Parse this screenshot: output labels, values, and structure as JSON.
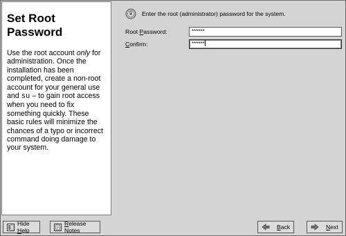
{
  "help": {
    "title": "Set Root Password",
    "para_1": "Use the root account ",
    "para_only": "only",
    "para_2": " for administration. Once the installation has been completed, create a non-root account for your general use and ",
    "para_cmd": "su",
    "para_3": "  – to gain root access when you need to fix something quickly. These basic rules will minimize the chances of a typo or incorrect command doing damage to your system."
  },
  "intro": {
    "text": "Enter the root (administrator) password for the system.",
    "icon": "shield-badge-icon"
  },
  "form": {
    "root_password_label_pre": "Root ",
    "root_password_label_key": "P",
    "root_password_label_post": "assword:",
    "root_password_value": "******",
    "confirm_label_key": "C",
    "confirm_label_post": "onfirm:",
    "confirm_value": "******"
  },
  "buttons": {
    "hide_help_pre": "Hide ",
    "hide_help_key": "H",
    "hide_help_post": "elp",
    "release_notes_key": "R",
    "release_notes_post": "elease Notes",
    "back_key": "B",
    "back_post": "ack",
    "next_key": "N",
    "next_post": "ext"
  },
  "colors": {
    "panel_bg": "#d4d4d4",
    "help_bg": "#ffffff"
  }
}
